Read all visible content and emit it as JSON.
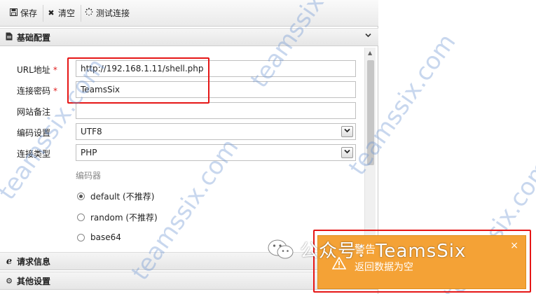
{
  "toolbar": {
    "save": {
      "label": "保存",
      "icon": "floppy-icon"
    },
    "clear": {
      "label": "清空",
      "icon": "x-icon"
    },
    "test": {
      "label": "测试连接",
      "icon": "spinner-icon"
    }
  },
  "sections": {
    "basic": "基础配置",
    "request": "请求信息",
    "other": "其他设置"
  },
  "form": {
    "url": {
      "label": "URL地址",
      "required": "*",
      "value": "http://192.168.1.11/shell.php"
    },
    "password": {
      "label": "连接密码",
      "required": "*",
      "value": "TeamsSix"
    },
    "note": {
      "label": "网站备注",
      "value": ""
    },
    "encoding": {
      "label": "编码设置",
      "value": "UTF8"
    },
    "type": {
      "label": "连接类型",
      "value": "PHP"
    },
    "encoder": {
      "title": "编码器",
      "options": [
        "default (不推荐)",
        "random (不推荐)",
        "base64"
      ],
      "selected": "default (不推荐)"
    }
  },
  "toast": {
    "title": "警告",
    "message": "返回数据为空",
    "close": "×"
  },
  "watermark": {
    "text": "teamssix.com",
    "wechat": "公众号：TeamsSix"
  },
  "colors": {
    "toast_bg": "#f4a236",
    "highlight": "#e51616",
    "required": "#e02020"
  }
}
